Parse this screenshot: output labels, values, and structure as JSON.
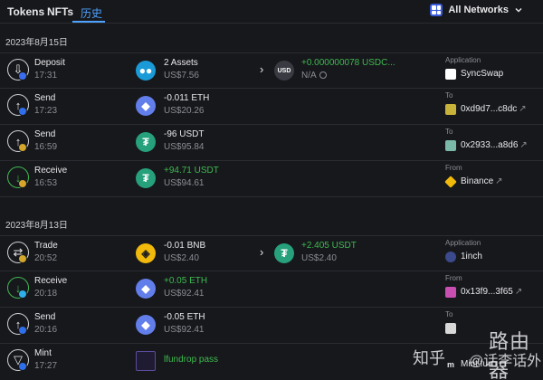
{
  "tabs": [
    "Tokens",
    "NFTs",
    "历史"
  ],
  "network": {
    "label": "All Networks"
  },
  "groups": [
    {
      "date": "2023年8月15日"
    },
    {
      "date": "2023年8月13日"
    }
  ],
  "rows": [
    {
      "type": "Deposit",
      "time": "17:31",
      "coin_icon": "multi-asset-icon",
      "amount": "2 Assets",
      "usd": "US$7.56",
      "to_coin_icon": "usd-icon",
      "to_coin_text": "USD",
      "to_amount": "+0.000000078 USDC...",
      "to_usd": "N/A",
      "cp_label": "Application",
      "cp_name": "SyncSwap",
      "cp_icon": "syncswap-icon",
      "cp_color": "#ffffff"
    },
    {
      "type": "Send",
      "time": "17:23",
      "coin_icon": "eth-icon",
      "amount": "-0.011 ETH",
      "usd": "US$20.26",
      "cp_label": "To",
      "cp_name": "0xd9d7...c8dc",
      "cp_icon": "avatar-icon",
      "cp_color": "#c9b23a"
    },
    {
      "type": "Send",
      "time": "16:59",
      "coin_icon": "usdt-icon",
      "amount": "-96 USDT",
      "usd": "US$95.84",
      "cp_label": "To",
      "cp_name": "0x2933...a8d6",
      "cp_icon": "avatar-icon",
      "cp_color": "#7ab8a8"
    },
    {
      "type": "Receive",
      "time": "16:53",
      "coin_icon": "usdt-icon",
      "amount": "+94.71 USDT",
      "usd": "US$94.61",
      "cp_label": "From",
      "cp_name": "Binance",
      "cp_icon": "binance-icon",
      "cp_color": "#f0b90b"
    },
    {
      "type": "Trade",
      "time": "20:52",
      "coin_icon": "bnb-icon",
      "amount": "-0.01 BNB",
      "usd": "US$2.40",
      "to_coin_icon": "usdt-icon",
      "to_amount": "+2.405 USDT",
      "to_usd": "US$2.40",
      "cp_label": "Application",
      "cp_name": "1inch",
      "cp_icon": "1inch-icon",
      "cp_color": "#3b4a8c"
    },
    {
      "type": "Receive",
      "time": "20:18",
      "coin_icon": "eth-icon",
      "amount": "+0.05 ETH",
      "usd": "US$92.41",
      "cp_label": "From",
      "cp_name": "0x13f9...3f65",
      "cp_icon": "avatar-icon",
      "cp_color": "#c84fb0"
    },
    {
      "type": "Send",
      "time": "20:16",
      "coin_icon": "eth-icon",
      "amount": "-0.05 ETH",
      "usd": "US$92.41",
      "cp_label": "To",
      "cp_name": "",
      "cp_icon": "avatar-icon",
      "cp_color": "#d8d8d8"
    },
    {
      "type": "Mint",
      "time": "17:27",
      "coin_icon": "nft-icon",
      "amount": "lfundrop pass",
      "usd": "",
      "cp_label": "",
      "cp_name": "Mint.fun",
      "cp_icon": "mintfun-icon",
      "cp_color": "#e8e8ea"
    }
  ],
  "watermark": {
    "brand": "路由器",
    "site": "知乎",
    "author": "@话李话外"
  },
  "colors": {
    "accent": "#4da3ff",
    "positive": "#3fb950",
    "background": "#17181c"
  }
}
